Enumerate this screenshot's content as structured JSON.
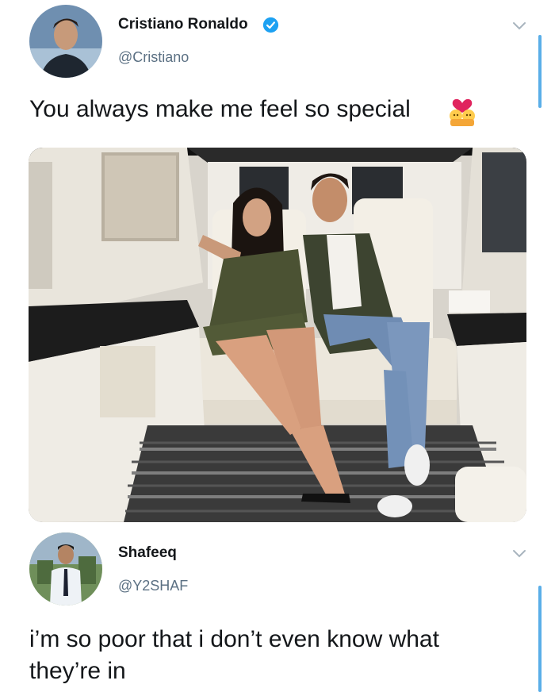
{
  "tweet": {
    "author_name": "Cristiano Ronaldo",
    "author_handle": "@Cristiano",
    "text": "You always make me feel so special",
    "emoji": "couple-with-heart-emoji"
  },
  "reply": {
    "author_name": "Shafeeq",
    "author_handle": "@Y2SHAF",
    "text_line1": "i’m so poor that i don’t even know what",
    "text_line2": "they’re in"
  },
  "colors": {
    "verified": "#1da1f2",
    "handle": "#5b7083",
    "side_bar": "#5aaee8"
  }
}
